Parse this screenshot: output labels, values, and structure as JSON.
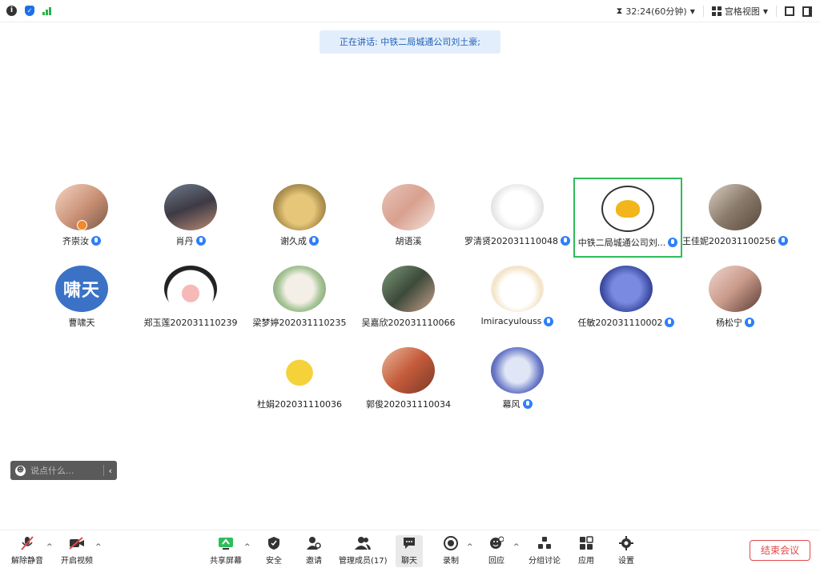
{
  "topbar": {
    "info_icon": "info-icon",
    "security_icon": "shield-icon",
    "signal_icon": "signal-icon",
    "timer": "32:24(60分钟)",
    "view_mode": "宫格视图"
  },
  "speaking": {
    "text": "正在讲话: 中铁二局城通公司刘土豪;"
  },
  "participants": [
    {
      "name": "齐崇汝"
    },
    {
      "name": "肖丹"
    },
    {
      "name": "谢久成"
    },
    {
      "name": "胡语溪"
    },
    {
      "name": "罗清贤202031110048"
    },
    {
      "name": "中铁二局城通公司刘..."
    },
    {
      "name": "王佳妮202031100256"
    },
    {
      "name": "曹啸天",
      "avatar_text": "啸天"
    },
    {
      "name": "郑玉莲202031110239"
    },
    {
      "name": "梁梦婷202031110235"
    },
    {
      "name": "吴嘉欣202031110066"
    },
    {
      "name": "lmiracyulouss"
    },
    {
      "name": "任敏202031110002"
    },
    {
      "name": "杨松宁"
    },
    {
      "name": "杜娟202031110036"
    },
    {
      "name": "郭俊202031110034"
    },
    {
      "name": "幕风"
    }
  ],
  "chat": {
    "placeholder": "说点什么..."
  },
  "toolbar": {
    "unmute": "解除静音",
    "start_video": "开启视频",
    "share_screen": "共享屏幕",
    "security": "安全",
    "invite": "邀请",
    "manage_members": "管理成员(17)",
    "chat": "聊天",
    "record": "录制",
    "reaction": "回应",
    "breakout": "分组讨论",
    "apps": "应用",
    "settings": "设置",
    "end_meeting": "结束会议"
  },
  "colors": {
    "accent_blue": "#2d7ff9",
    "active_green": "#2dbd5a",
    "end_red": "#e34a4a",
    "speaking_bg": "#e3eefc"
  }
}
